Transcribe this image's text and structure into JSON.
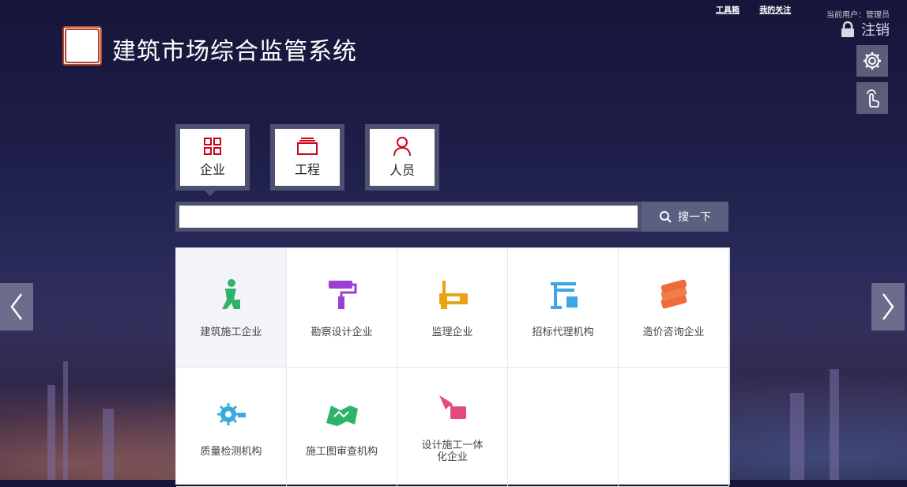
{
  "header": {
    "title": "建筑市场综合监管系统",
    "links": [
      "工具箱",
      "我的关注"
    ],
    "current_user": "当前用户：管理员",
    "logout": "注销"
  },
  "categories": [
    {
      "label": "企业",
      "icon": "grid-icon",
      "active": true
    },
    {
      "label": "工程",
      "icon": "stack-icon",
      "active": false
    },
    {
      "label": "人员",
      "icon": "person-icon",
      "active": false
    }
  ],
  "search": {
    "placeholder": "",
    "button": "搜一下"
  },
  "items": [
    {
      "label": "建筑施工企业",
      "icon": "worker-icon",
      "color": "#2db36a"
    },
    {
      "label": "勘察设计企业",
      "icon": "paint-roller-icon",
      "color": "#9a3fd1"
    },
    {
      "label": "监理企业",
      "icon": "level-icon",
      "color": "#e8a316"
    },
    {
      "label": "招标代理机构",
      "icon": "crane-icon",
      "color": "#3aa7e6"
    },
    {
      "label": "造价咨询企业",
      "icon": "money-icon",
      "color": "#ef6b3a"
    },
    {
      "label": "质量检测机构",
      "icon": "gear-icon",
      "color": "#39a9de"
    },
    {
      "label": "施工图审查机构",
      "icon": "blueprint-icon",
      "color": "#2db36a"
    },
    {
      "label": "设计施工一体化企业",
      "icon": "tools-icon",
      "color": "#e44a7a"
    }
  ]
}
